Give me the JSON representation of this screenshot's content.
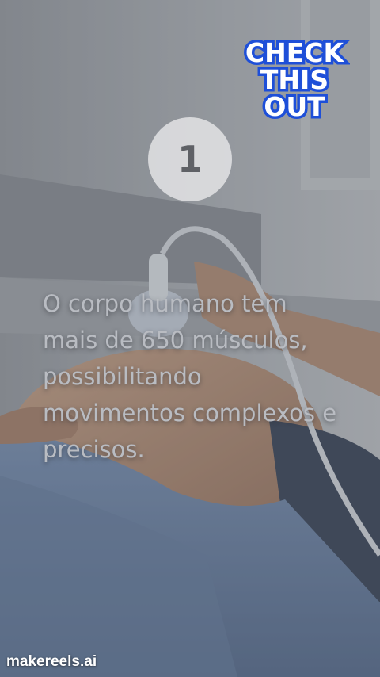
{
  "badge": {
    "lines": [
      "CHECK",
      "THIS",
      "OUT"
    ],
    "fill": "#ffffff",
    "outline": "#1e4fd8"
  },
  "step": {
    "number": "1"
  },
  "caption": {
    "text": "O corpo humano tem mais de 650 músculos, possibilitando movimentos complexos e precisos."
  },
  "watermark": {
    "text": "makereels.ai"
  },
  "background": {
    "description_icon": "ultrasound-scene-image"
  }
}
